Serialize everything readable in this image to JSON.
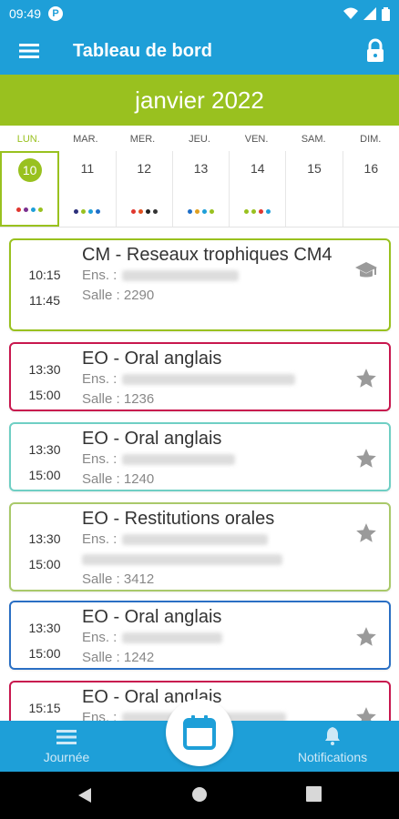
{
  "status_bar": {
    "time": "09:49",
    "notification_badge": "P",
    "icons": [
      "wifi-icon",
      "signal-icon",
      "battery-icon"
    ]
  },
  "app_bar": {
    "title": "Tableau de bord",
    "menu_icon": "hamburger-menu-icon",
    "lock_icon": "lock-icon"
  },
  "calendar": {
    "month": "janvier 2022",
    "weekdays": [
      "LUN.",
      "MAR.",
      "MER.",
      "JEU.",
      "VEN.",
      "SAM.",
      "DIM."
    ],
    "days": [
      {
        "num": "10",
        "active": true,
        "dots": [
          "#e0372f",
          "#7a2f8e",
          "#1e9fd8",
          "#99c11f"
        ]
      },
      {
        "num": "11",
        "active": false,
        "dots": [
          "#2c2f7a",
          "#99c11f",
          "#1e9fd8",
          "#1e6ec8"
        ]
      },
      {
        "num": "12",
        "active": false,
        "dots": [
          "#e0372f",
          "#e05020",
          "#222222",
          "#333333"
        ]
      },
      {
        "num": "13",
        "active": false,
        "dots": [
          "#1e6ec8",
          "#e0a020",
          "#1e9fd8",
          "#99c11f"
        ]
      },
      {
        "num": "14",
        "active": false,
        "dots": [
          "#99c11f",
          "#99c11f",
          "#e0372f",
          "#1e9fd8"
        ]
      },
      {
        "num": "15",
        "active": false,
        "dots": []
      },
      {
        "num": "16",
        "active": false,
        "dots": []
      }
    ],
    "accent_color": "#99c11f"
  },
  "events": [
    {
      "start": "10:15",
      "end": "11:45",
      "title": "CM - Reseaux trophiques CM4",
      "teacher_label": "Ens. :",
      "room": "Salle : 2290",
      "color": "#99c11f",
      "icon": "graduation-cap-icon"
    },
    {
      "start": "13:30",
      "end": "15:00",
      "title": "EO - Oral anglais",
      "teacher_label": "Ens. :",
      "room": "Salle : 1236",
      "color": "#c8174e",
      "icon": "star-icon"
    },
    {
      "start": "13:30",
      "end": "15:00",
      "title": "EO - Oral anglais",
      "teacher_label": "Ens. :",
      "room": "Salle : 1240",
      "color": "#6fcfc4",
      "icon": "star-icon"
    },
    {
      "start": "13:30",
      "end": "15:00",
      "title": "EO - Restitutions orales",
      "teacher_label": "Ens. :",
      "room": "Salle : 3412",
      "color": "#a9c96a",
      "icon": "star-icon"
    },
    {
      "start": "13:30",
      "end": "15:00",
      "title": "EO - Oral anglais",
      "teacher_label": "Ens. :",
      "room": "Salle : 1242",
      "color": "#2a6fc4",
      "icon": "star-icon"
    },
    {
      "start": "15:15",
      "end": "",
      "title": "EO - Oral anglais",
      "teacher_label": "Ens. :",
      "room": "",
      "color": "#c8174e",
      "icon": "star-icon"
    }
  ],
  "bottom_nav": {
    "left_label": "Journée",
    "right_label": "Notifications",
    "fab_icon": "calendar-icon",
    "bar_color": "#1e9fd8"
  }
}
